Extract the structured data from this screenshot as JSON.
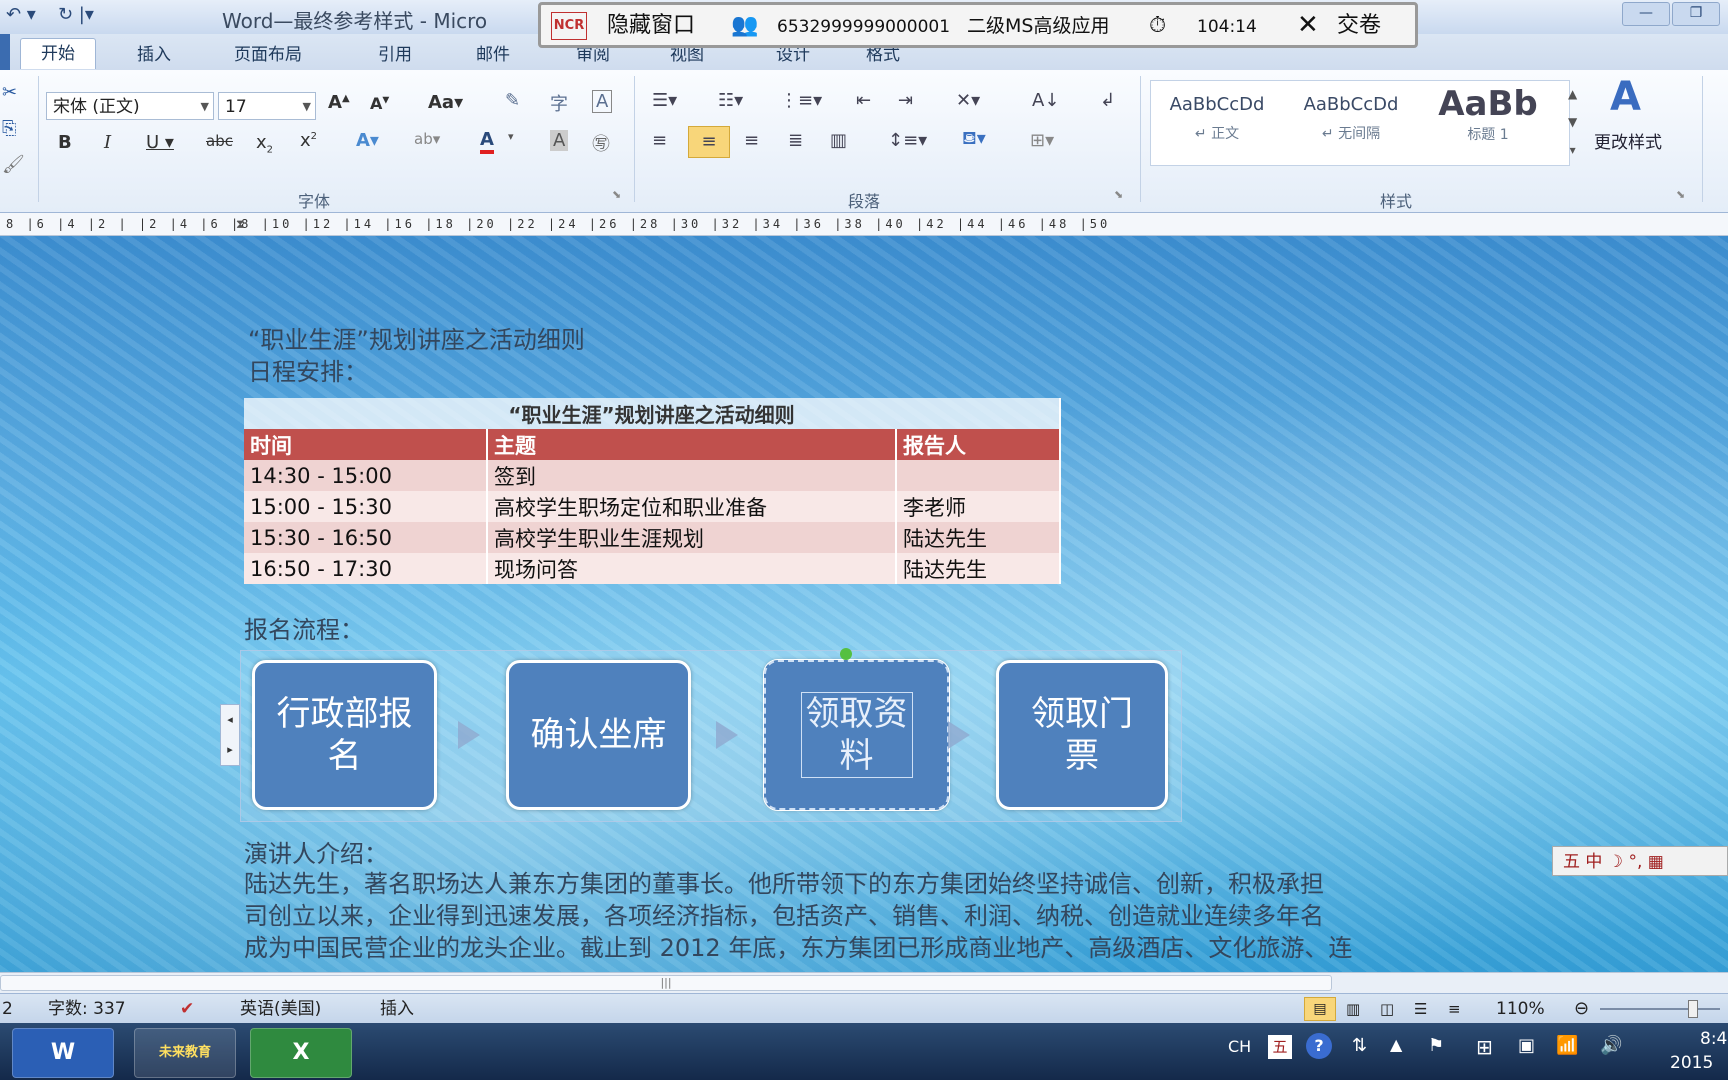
{
  "titlebar": {
    "title": "Word—最终参考样式 - Micro"
  },
  "exam_bar": {
    "logo": "NCR",
    "hide_window": "隐藏窗口",
    "exam_id": "6532999999000001",
    "subject": "二级MS高级应用",
    "timer": "104:14",
    "submit": "交卷"
  },
  "tabs": [
    "开始",
    "插入",
    "页面布局",
    "引用",
    "邮件",
    "审阅",
    "视图",
    "设计",
    "格式"
  ],
  "ribbon": {
    "font_name": "宋体 (正文)",
    "font_size": "17",
    "group_font": "字体",
    "group_paragraph": "段落",
    "group_styles": "样式",
    "styles": [
      {
        "preview": "AaBbCcDd",
        "name": "↵ 正文"
      },
      {
        "preview": "AaBbCcDd",
        "name": "↵ 无间隔"
      },
      {
        "preview": "AaBb",
        "name": "标题 1"
      }
    ],
    "change_styles": "更改样式"
  },
  "ruler": "8 |6 |4 |2 |  |2 |4 |6 |8 |10 |12 |14 |16 |18 |20 |22 |24 |26 |28 |30 |32 |34 |36 |38 |40 |42 |44 |46 |48 |50",
  "document": {
    "heading": "“职业生涯”规划讲座之活动细则",
    "schedule_label": "日程安排：",
    "table": {
      "caption": "“职业生涯”规划讲座之活动细则",
      "headers": [
        "时间",
        "主题",
        "报告人"
      ],
      "rows": [
        [
          "14:30 - 15:00",
          "签到",
          ""
        ],
        [
          "15:00 - 15:30",
          "高校学生职场定位和职业准备",
          "李老师"
        ],
        [
          "15:30 - 16:50",
          "高校学生职业生涯规划",
          "陆达先生"
        ],
        [
          "16:50 - 17:30",
          "现场问答",
          "陆达先生"
        ]
      ]
    },
    "registration_label": "报名流程：",
    "flow": [
      "行政部报名",
      "确认坐席",
      "领取资料",
      "领取门票"
    ],
    "speaker_label": "演讲人介绍：",
    "paragraph_lines": [
      "陆达先生，著名职场达人兼东方集团的董事长。他所带领下的东方集团始终坚持诚信、创新，积极承担",
      "司创立以来，企业得到迅速发展，各项经济指标，包括资产、销售、利润、纳税、创造就业连续多年名",
      "成为中国民营企业的龙头企业。截止到 2012 年底，东方集团已形成商业地产、高级酒店、文化旅游、连"
    ]
  },
  "ime_bar": "五 中 ☽ °, ▦",
  "statusbar": {
    "page": "2",
    "word_count": "字数: 337",
    "language": "英语(美国)",
    "mode": "插入",
    "zoom": "110%"
  },
  "taskbar": {
    "apps": [
      "W",
      "未来教育",
      "X"
    ],
    "lang": "CH",
    "ime": "五",
    "clock_time": "8:4",
    "clock_date": "2015"
  }
}
